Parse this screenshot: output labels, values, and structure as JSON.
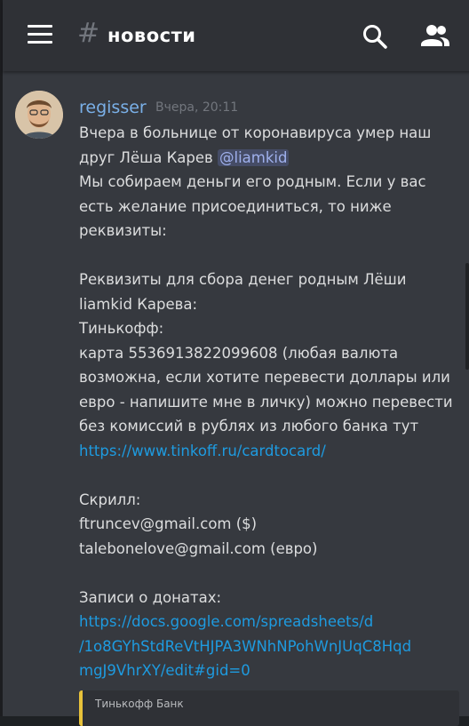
{
  "header": {
    "hash": "#",
    "channel": "новости"
  },
  "message": {
    "author": "regisser",
    "timestamp": "Вчера, 20:11",
    "line1": "Вчера в больнице от коронавируса умер наш",
    "line2_prefix": "друг Лёша Карев ",
    "mention": "@liamkid",
    "para1": "Мы собираем деньги его родным. Если у вас\nесть желание присоединиться, то ниже\nреквизиты:\n\nРеквизиты для сбора денег родным Лёши\nliamkid Карева:\nТинькофф:\nкарта 5536913822099608 (любая валюта\nвозможна, если хотите перевести доллары или\nевро - напишите мне в личку) можно перевести\nбез комиссий в рублях из любого банка тут",
    "link1": "https://www.tinkoff.ru/cardtocard/",
    "para2": "\nСкрилл:\nftruncev@gmail.com ($)\ntalebonelove@gmail.com (евро)\n\nЗаписи о донатах:",
    "link2": "https://docs.google.com/spreadsheets/d/1o8GYhStdReVtHJPA3WNhNPohWnJUqC8HqdmgJ9VhrXY/edit#gid=0",
    "link2_display": "https://docs.google.com/spreadsheets/d\n/1o8GYhStdReVtHJPA3WNhNPohWnJUqC8Hqd\nmgJ9VhrXY/edit#gid=0"
  },
  "embed": {
    "provider": "Тинькофф Банк",
    "accent": "#e8c23a"
  },
  "icons": {
    "menu": "hamburger-menu-icon",
    "search": "search-icon",
    "members": "members-icon"
  }
}
